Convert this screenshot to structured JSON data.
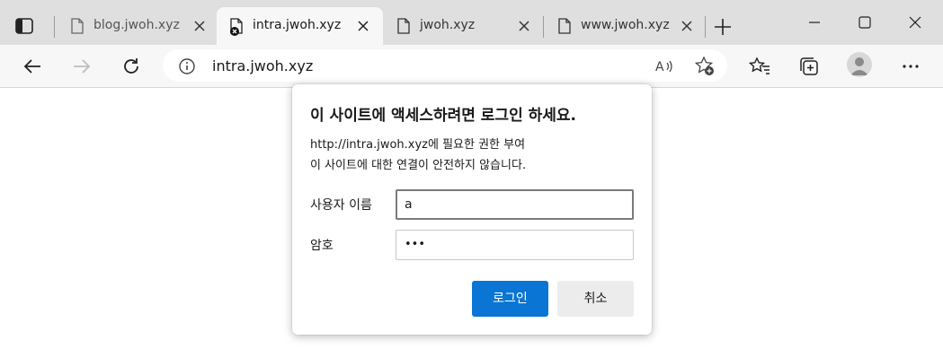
{
  "tabs": [
    {
      "title": "blog.jwoh.xyz",
      "active": false,
      "icon": "page-icon"
    },
    {
      "title": "intra.jwoh.xyz",
      "active": true,
      "icon": "page-error-icon"
    },
    {
      "title": "jwoh.xyz",
      "active": false,
      "icon": "page-icon"
    },
    {
      "title": "www.jwoh.xyz",
      "active": false,
      "icon": "page-icon"
    }
  ],
  "address": {
    "url": "intra.jwoh.xyz"
  },
  "dialog": {
    "title": "이 사이트에 액세스하려면 로그인 하세요.",
    "line1": "http://intra.jwoh.xyz에 필요한 권한 부여",
    "line2": "이 사이트에 대한 연결이 안전하지 않습니다.",
    "username_label": "사용자 이름",
    "username_value": "a",
    "password_label": "암호",
    "password_value": "•••",
    "login_button": "로그인",
    "cancel_button": "취소"
  },
  "colors": {
    "primary": "#0a75d3",
    "tabstrip": "#dfdfdf",
    "toolbar": "#f7f7f7"
  }
}
